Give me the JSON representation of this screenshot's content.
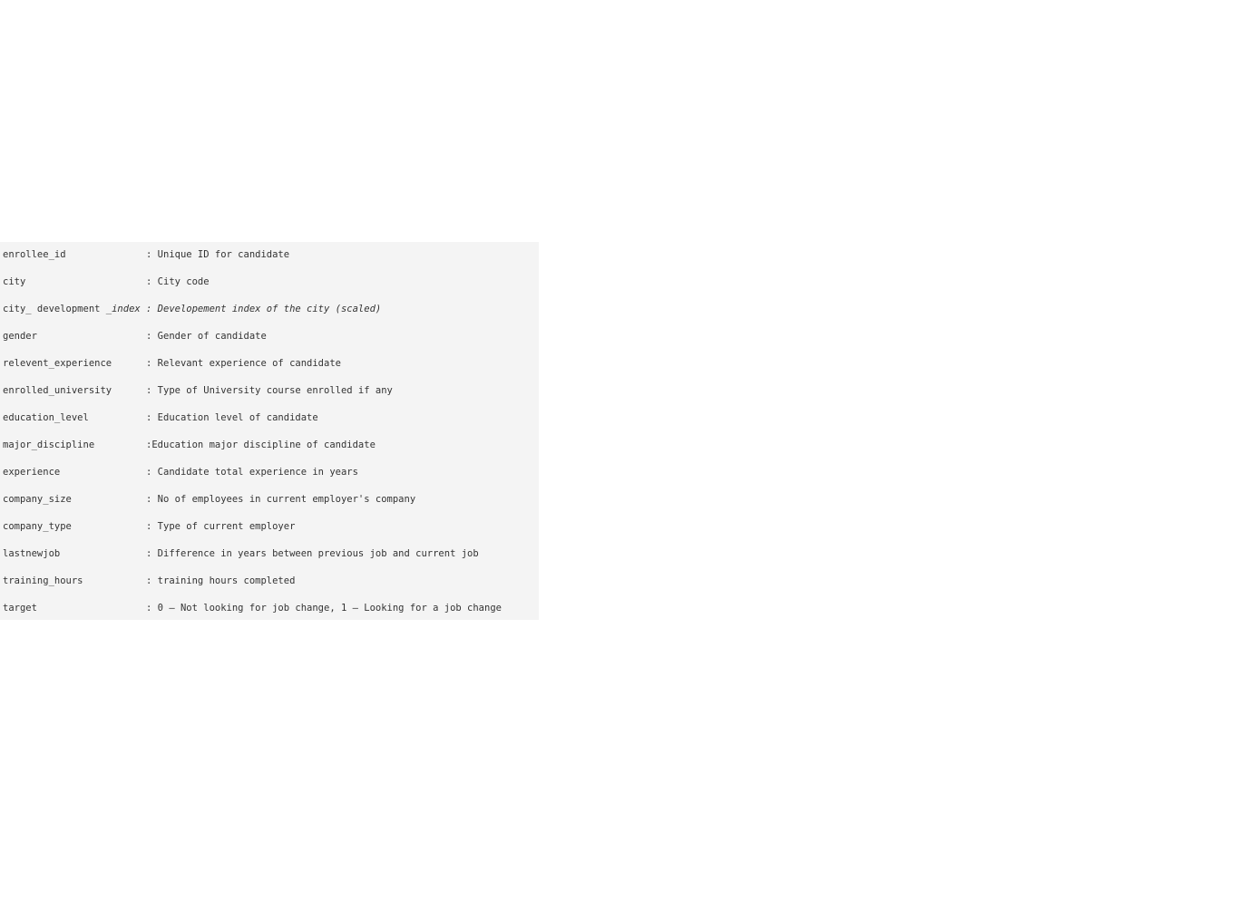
{
  "data_dictionary": {
    "lines": [
      {
        "text": "enrollee_id              : Unique ID for candidate"
      },
      {
        "text": "city                     : City code"
      },
      {
        "before": "city_ development _",
        "italic": "index : Developement index of the city (scaled)"
      },
      {
        "text": "gender                   : Gender of candidate"
      },
      {
        "text": "relevent_experience      : Relevant experience of candidate"
      },
      {
        "text": "enrolled_university      : Type of University course enrolled if any"
      },
      {
        "text": "education_level          : Education level of candidate"
      },
      {
        "text": "major_discipline         :Education major discipline of candidate"
      },
      {
        "text": "experience               : Candidate total experience in years"
      },
      {
        "text": "company_size             : No of employees in current employer's company"
      },
      {
        "text": "company_type             : Type of current employer"
      },
      {
        "text": "lastnewjob               : Difference in years between previous job and current job"
      },
      {
        "text": "training_hours           : training hours completed"
      },
      {
        "text": "target                   : 0 – Not looking for job change, 1 – Looking for a job change"
      }
    ]
  }
}
